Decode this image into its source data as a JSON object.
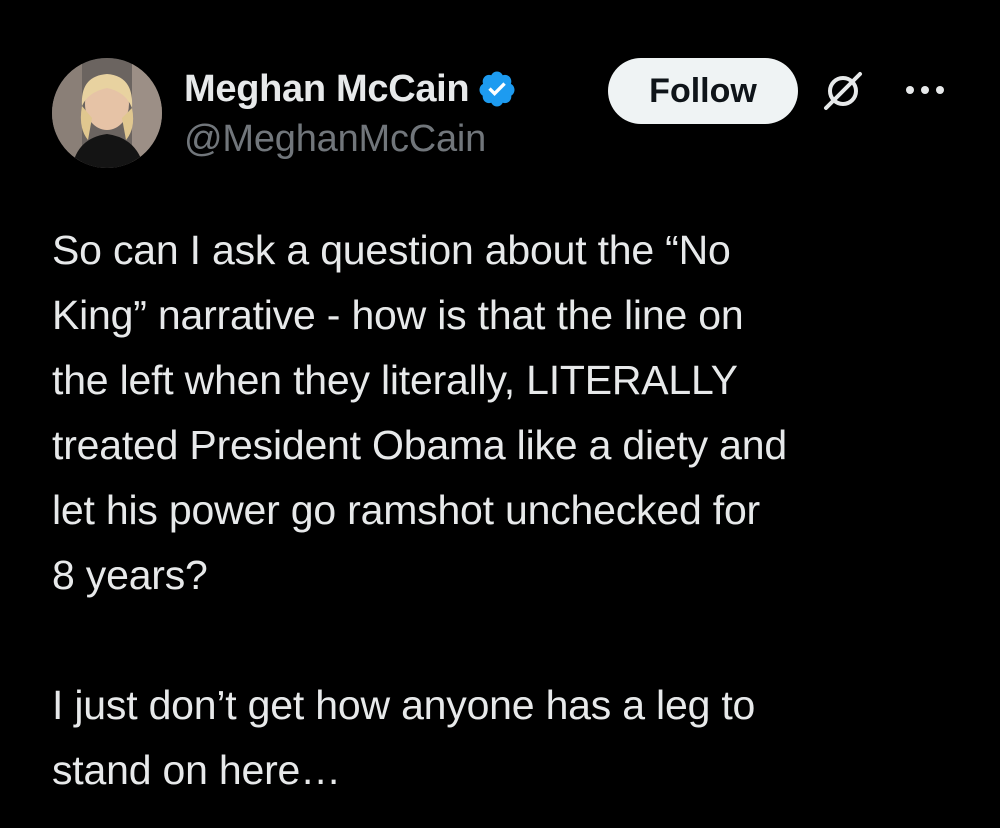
{
  "author": {
    "display_name": "Meghan McCain",
    "handle": "@MeghanMcCain",
    "verified": true,
    "verified_color": "#1d9bf0"
  },
  "actions": {
    "follow_label": "Follow",
    "grok_icon": "grok-icon",
    "more_icon": "more-horizontal-icon"
  },
  "tweet": {
    "lines": [
      "So can I ask a question about the “No",
      "King” narrative - how is that the line on",
      "the left when they literally, LITERALLY",
      "treated President Obama like a diety and",
      "let his power go ramshot unchecked for",
      "8 years?",
      "",
      "I just don’t get how anyone has a leg to",
      "stand on here…"
    ]
  },
  "colors": {
    "background": "#000000",
    "text": "#e7e9ea",
    "secondary_text": "#71767b",
    "follow_button_bg": "#eff3f4"
  }
}
